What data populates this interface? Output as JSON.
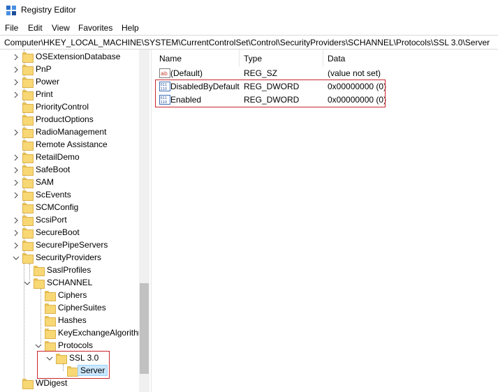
{
  "window": {
    "title": "Registry Editor"
  },
  "menu": [
    "File",
    "Edit",
    "View",
    "Favorites",
    "Help"
  ],
  "address": "Computer\\HKEY_LOCAL_MACHINE\\SYSTEM\\CurrentControlSet\\Control\\SecurityProviders\\SCHANNEL\\Protocols\\SSL 3.0\\Server",
  "tree": {
    "items": [
      {
        "label": "OSExtensionDatabase",
        "expander": "collapsed"
      },
      {
        "label": "PnP",
        "expander": "collapsed"
      },
      {
        "label": "Power",
        "expander": "collapsed"
      },
      {
        "label": "Print",
        "expander": "collapsed"
      },
      {
        "label": "PriorityControl",
        "expander": "none"
      },
      {
        "label": "ProductOptions",
        "expander": "none"
      },
      {
        "label": "RadioManagement",
        "expander": "collapsed"
      },
      {
        "label": "Remote Assistance",
        "expander": "none"
      },
      {
        "label": "RetailDemo",
        "expander": "collapsed"
      },
      {
        "label": "SafeBoot",
        "expander": "collapsed"
      },
      {
        "label": "SAM",
        "expander": "collapsed"
      },
      {
        "label": "ScEvents",
        "expander": "collapsed"
      },
      {
        "label": "SCMConfig",
        "expander": "none"
      },
      {
        "label": "ScsiPort",
        "expander": "collapsed"
      },
      {
        "label": "SecureBoot",
        "expander": "collapsed"
      },
      {
        "label": "SecurePipeServers",
        "expander": "collapsed"
      },
      {
        "label": "SecurityProviders",
        "expander": "expanded"
      },
      {
        "label": "SaslProfiles",
        "expander": "none"
      },
      {
        "label": "SCHANNEL",
        "expander": "expanded"
      },
      {
        "label": "Ciphers",
        "expander": "none"
      },
      {
        "label": "CipherSuites",
        "expander": "none"
      },
      {
        "label": "Hashes",
        "expander": "none"
      },
      {
        "label": "KeyExchangeAlgorithms",
        "expander": "none"
      },
      {
        "label": "Protocols",
        "expander": "expanded"
      },
      {
        "label": "SSL 3.0",
        "expander": "expanded"
      },
      {
        "label": "Server",
        "expander": "none",
        "selected": true
      },
      {
        "label": "WDigest",
        "expander": "none"
      }
    ]
  },
  "list": {
    "columns": [
      "Name",
      "Type",
      "Data"
    ],
    "rows": [
      {
        "icon": "string-value-icon",
        "name": "(Default)",
        "type": "REG_SZ",
        "data": "(value not set)"
      },
      {
        "icon": "dword-value-icon",
        "name": "DisabledByDefault",
        "type": "REG_DWORD",
        "data": "0x00000000 (0)"
      },
      {
        "icon": "dword-value-icon",
        "name": "Enabled",
        "type": "REG_DWORD",
        "data": "0x00000000 (0)"
      }
    ]
  },
  "colors": {
    "highlight": "#c9252b",
    "selection": "#cce8ff",
    "folder": "#f8d775"
  }
}
